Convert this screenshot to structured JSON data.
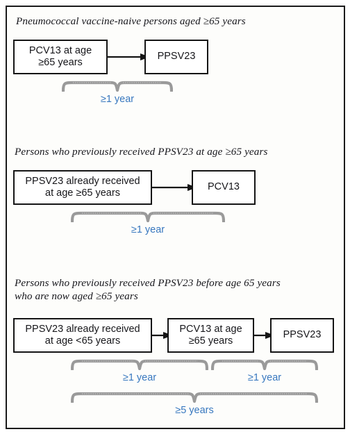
{
  "figure": {
    "background_color": "#fdfdfb",
    "border_color": "#1a1a1a",
    "box_border_color": "#151515",
    "box_text_color": "#16161a",
    "heading_color": "#17171c",
    "interval_label_color": "#3878bf",
    "brace_color": "#9a9a9a"
  },
  "sections": [
    {
      "heading": "Pneumococcal vaccine-naive persons aged ≥65 years",
      "boxes": [
        {
          "label": "PCV13 at age\n≥65 years"
        },
        {
          "label": "PPSV23"
        }
      ],
      "arrows": [
        {
          "name": "arrow-pcv13-to-ppsv23"
        }
      ],
      "intervals": [
        {
          "label": "≥1 year"
        }
      ]
    },
    {
      "heading": "Persons who previously received PPSV23 at age ≥65 years",
      "boxes": [
        {
          "label": "PPSV23 already received\nat age ≥65 years"
        },
        {
          "label": "PCV13"
        }
      ],
      "arrows": [
        {
          "name": "arrow-ppsv23-to-pcv13"
        }
      ],
      "intervals": [
        {
          "label": "≥1 year"
        }
      ]
    },
    {
      "heading": "Persons who previously received PPSV23 before age 65 years\nwho are now aged ≥65 years",
      "boxes": [
        {
          "label": "PPSV23 already received\nat age <65 years"
        },
        {
          "label": "PCV13 at age\n≥65 years"
        },
        {
          "label": "PPSV23"
        }
      ],
      "arrows": [
        {
          "name": "arrow-ppsv23-to-pcv13"
        },
        {
          "name": "arrow-pcv13-to-ppsv23"
        }
      ],
      "intervals": [
        {
          "label": "≥1 year"
        },
        {
          "label": "≥1 year"
        },
        {
          "label": "≥5 years"
        }
      ]
    }
  ]
}
